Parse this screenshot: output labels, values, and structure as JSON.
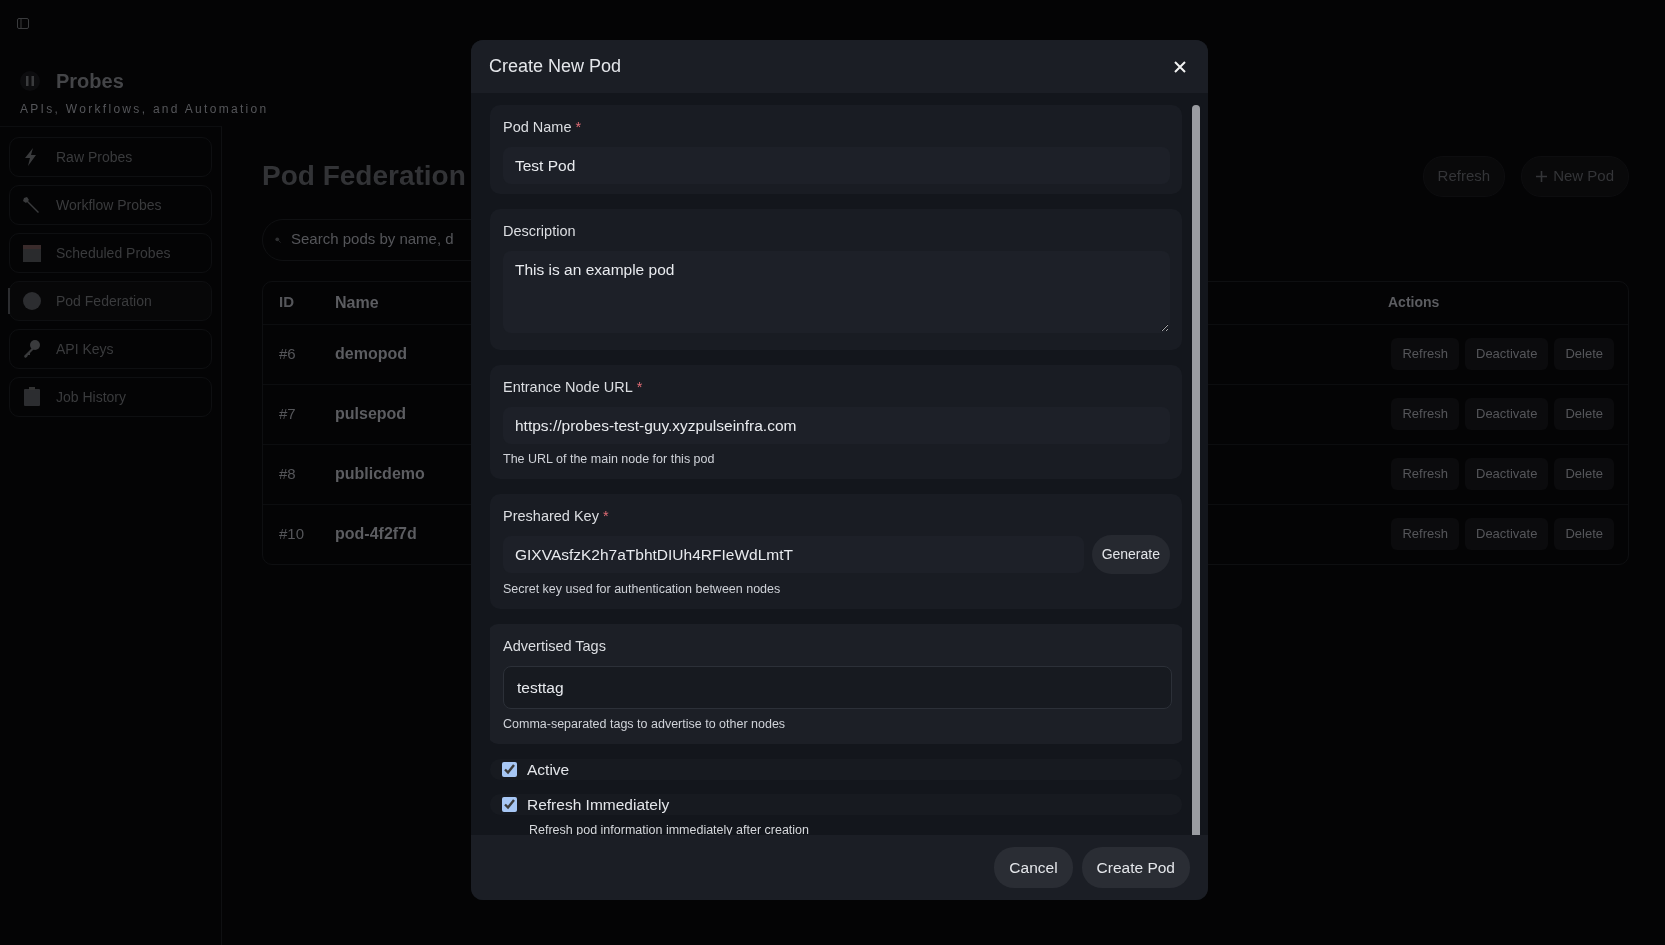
{
  "brand": {
    "title": "Probes",
    "subtitle": "APIs, Workflows, and Automation"
  },
  "sidebar": {
    "items": [
      {
        "label": "Raw Probes",
        "selected": false
      },
      {
        "label": "Workflow Probes",
        "selected": false
      },
      {
        "label": "Scheduled Probes",
        "selected": false
      },
      {
        "label": "Pod Federation",
        "selected": true
      },
      {
        "label": "API Keys",
        "selected": false
      },
      {
        "label": "Job History",
        "selected": false
      }
    ]
  },
  "page": {
    "title": "Pod Federation",
    "buttons": [
      {
        "label": "Refresh",
        "kind": "plain"
      },
      {
        "label": "New Pod",
        "kind": "add"
      }
    ],
    "search": {
      "placeholder": "Search pods by name, d"
    },
    "table": {
      "columns": [
        "ID",
        "Name",
        "Actions"
      ],
      "rows": [
        {
          "id": "#6",
          "name": "demopod",
          "actions": [
            "Refresh",
            "Deactivate",
            "Delete"
          ]
        },
        {
          "id": "#7",
          "name": "pulsepod",
          "actions": [
            "Refresh",
            "Deactivate",
            "Delete"
          ]
        },
        {
          "id": "#8",
          "name": "publicdemo",
          "actions": [
            "Refresh",
            "Deactivate",
            "Delete"
          ]
        },
        {
          "id": "#10",
          "name": "pod-4f2f7d",
          "actions": [
            "Refresh",
            "Deactivate",
            "Delete"
          ]
        }
      ]
    }
  },
  "modal": {
    "title": "Create New Pod",
    "fields": [
      {
        "kind": "text",
        "label": "Pod Name",
        "required_mark": "*",
        "value": "Test Pod",
        "focused": false
      },
      {
        "kind": "textarea",
        "label": "Description",
        "value": "This is an example pod",
        "focused": false
      },
      {
        "kind": "text",
        "label": "Entrance Node URL",
        "required_mark": "*",
        "value": "https://probes-test-guy.xyzpulseinfra.com",
        "help": "The URL of the main node for this pod",
        "focused": false
      },
      {
        "kind": "key",
        "label": "Preshared Key",
        "required_mark": "*",
        "value": "GIXVAsfzK2h7aTbhtDIUh4RFIeWdLmtT",
        "button": "Generate",
        "help": "Secret key used for authentication between nodes",
        "focused": false
      },
      {
        "kind": "text",
        "label": "Advertised Tags",
        "value": "testtag",
        "help": "Comma-separated tags to advertise to other nodes",
        "focused": true
      }
    ],
    "checkboxes": [
      {
        "label": "Active",
        "checked": true
      },
      {
        "label": "Refresh Immediately",
        "checked": true,
        "help": "Refresh pod information immediately after creation"
      }
    ],
    "buttons": [
      "Cancel",
      "Create Pod"
    ]
  }
}
